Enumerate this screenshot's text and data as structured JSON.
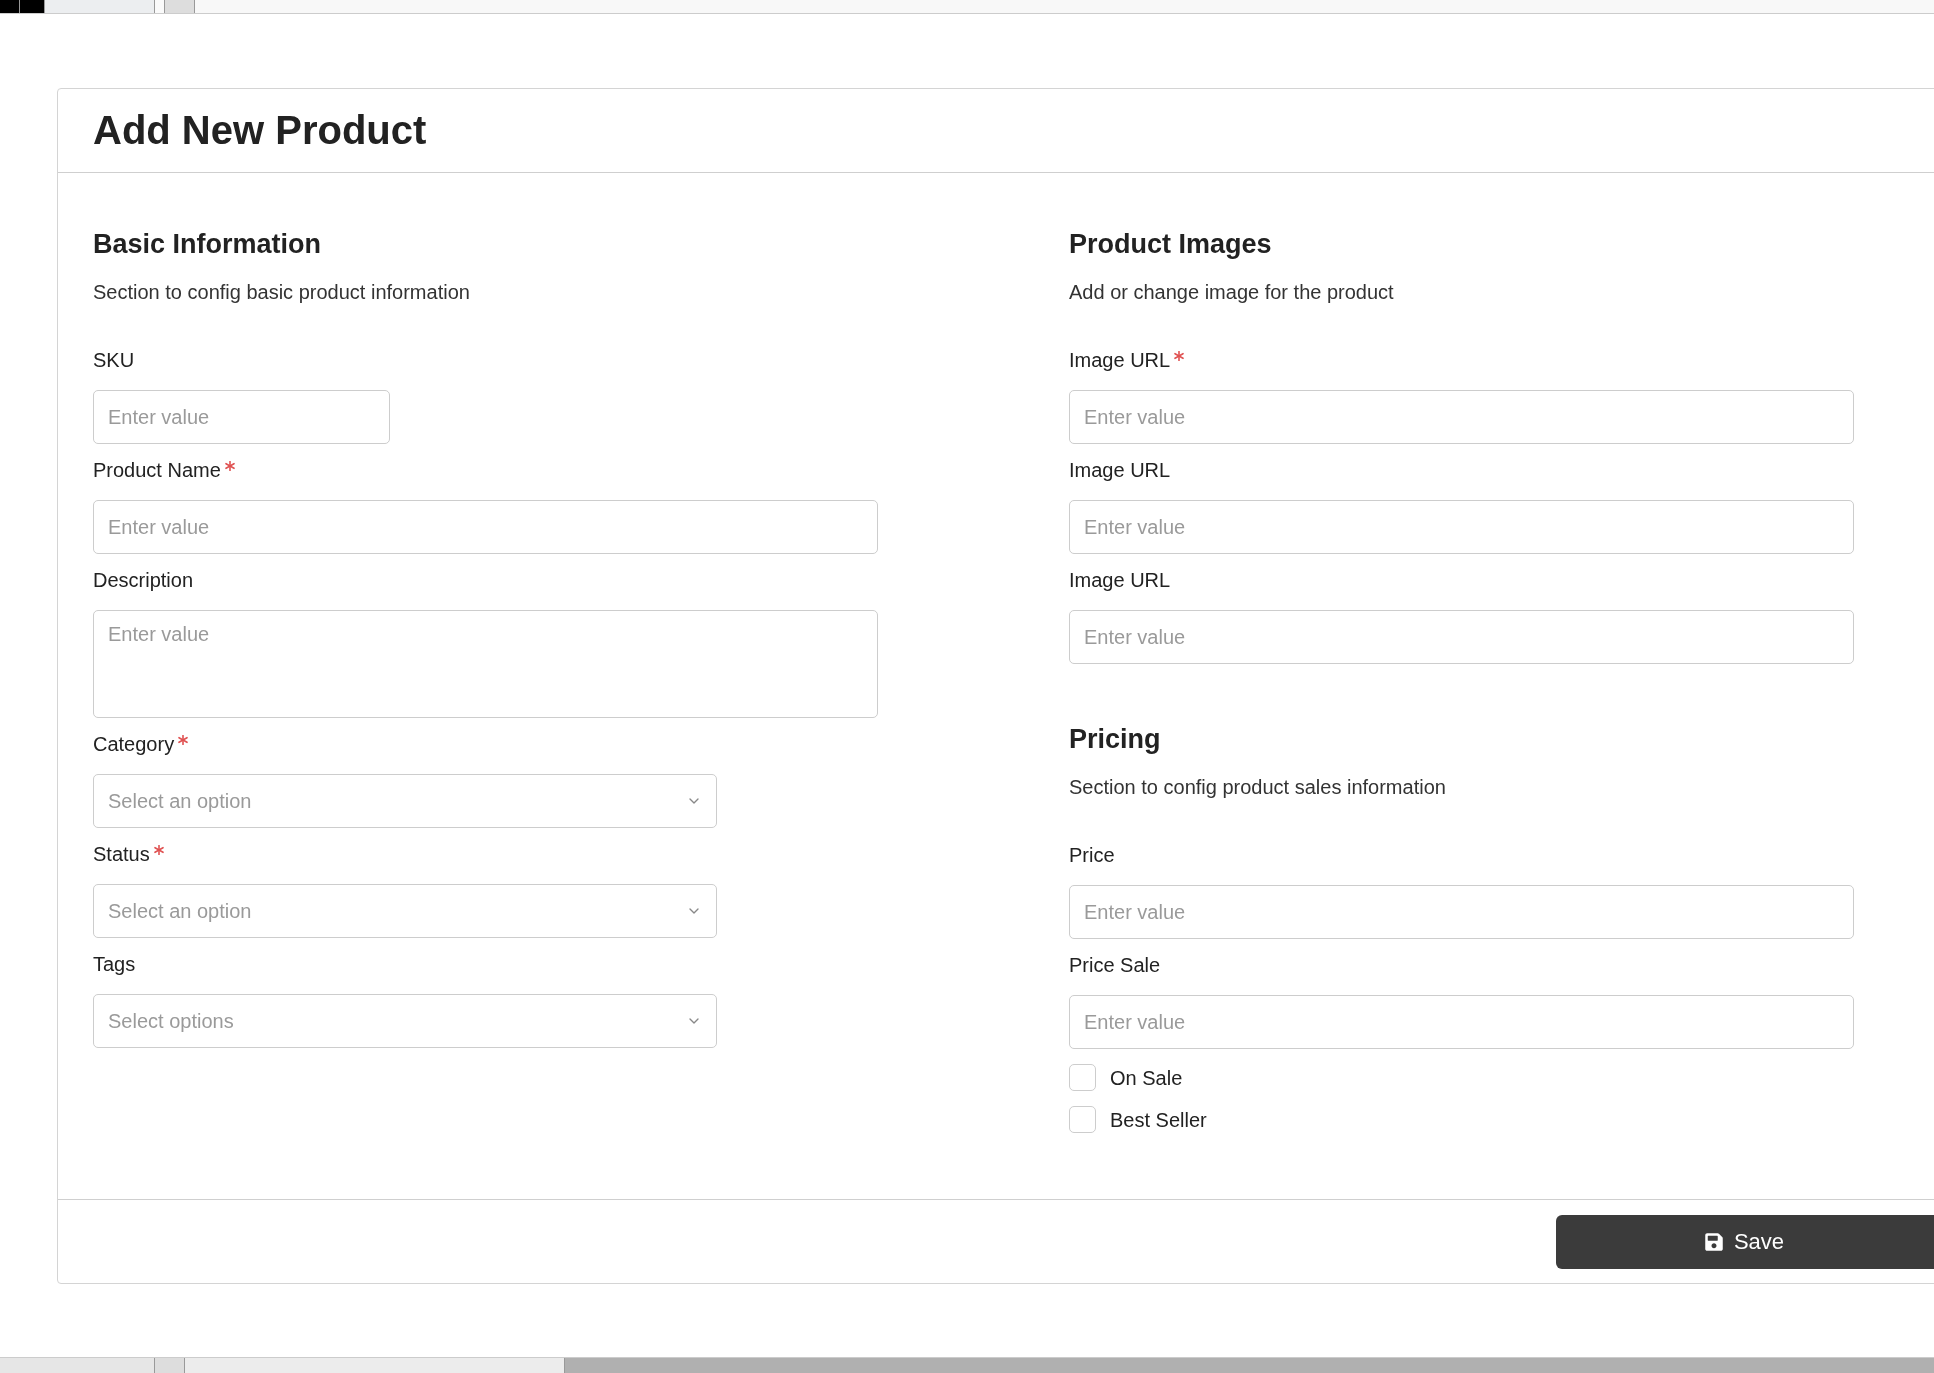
{
  "title": "Add New Product",
  "columns": [
    {
      "sections": [
        {
          "heading": "Basic Information",
          "subtitle": "Section to config basic product information",
          "fields": [
            {
              "kind": "short_text",
              "label": "SKU",
              "required": false,
              "placeholder": "Enter value"
            },
            {
              "kind": "text",
              "label": "Product Name",
              "required": true,
              "placeholder": "Enter value"
            },
            {
              "kind": "textarea",
              "label": "Description",
              "required": false,
              "placeholder": "Enter value"
            },
            {
              "kind": "select",
              "label": "Category",
              "required": true,
              "placeholder": "Select an option"
            },
            {
              "kind": "select",
              "label": "Status",
              "required": true,
              "placeholder": "Select an option"
            },
            {
              "kind": "select",
              "label": "Tags",
              "required": false,
              "placeholder": "Select options"
            }
          ]
        }
      ]
    },
    {
      "sections": [
        {
          "heading": "Product Images",
          "subtitle": "Add or change image for the product",
          "fields": [
            {
              "kind": "text",
              "label": "Image URL",
              "required": true,
              "placeholder": "Enter value"
            },
            {
              "kind": "text",
              "label": "Image URL",
              "required": false,
              "placeholder": "Enter value"
            },
            {
              "kind": "text",
              "label": "Image URL",
              "required": false,
              "placeholder": "Enter value"
            }
          ]
        },
        {
          "heading": "Pricing",
          "subtitle": "Section to config product sales information",
          "fields": [
            {
              "kind": "text",
              "label": "Price",
              "required": false,
              "placeholder": "Enter value"
            },
            {
              "kind": "text",
              "label": "Price Sale",
              "required": false,
              "placeholder": "Enter value"
            },
            {
              "kind": "checkbox",
              "label": "On Sale",
              "checked": false
            },
            {
              "kind": "checkbox",
              "label": "Best Seller",
              "checked": false
            }
          ]
        }
      ]
    }
  ],
  "save_button": {
    "label": "Save"
  }
}
